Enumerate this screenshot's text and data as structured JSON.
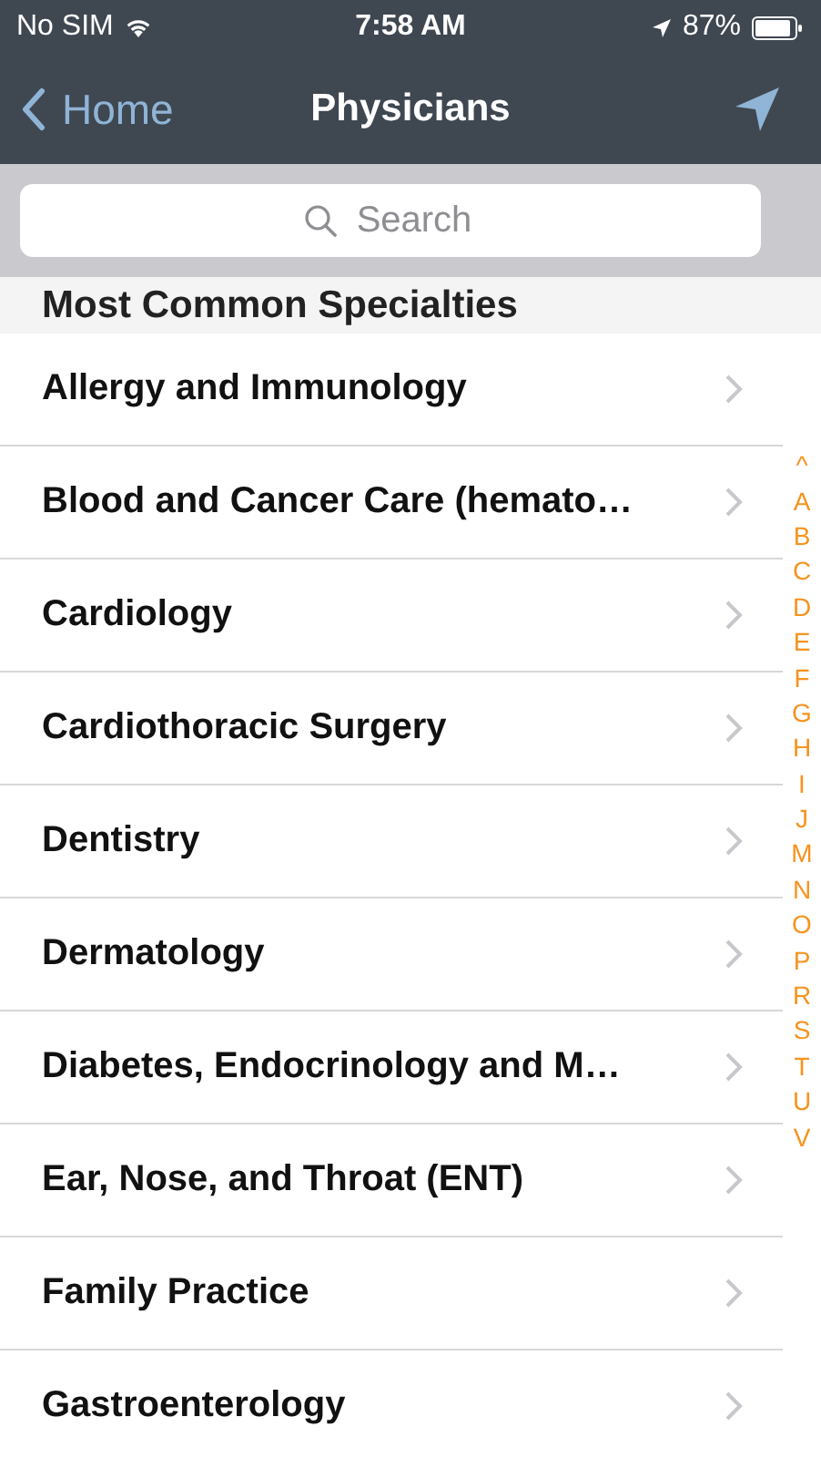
{
  "status_bar": {
    "carrier": "No SIM",
    "time": "7:58 AM",
    "battery": "87%"
  },
  "nav": {
    "back": "Home",
    "title": "Physicians"
  },
  "search": {
    "placeholder": "Search"
  },
  "section": {
    "title": "Most Common Specialties"
  },
  "rows": [
    "Allergy and Immunology",
    "Blood and Cancer Care (hemato…",
    "Cardiology",
    "Cardiothoracic Surgery",
    "Dentistry",
    "Dermatology",
    "Diabetes, Endocrinology and M…",
    "Ear, Nose, and Throat (ENT)",
    "Family Practice",
    "Gastroenterology"
  ],
  "index": [
    "^",
    "A",
    "B",
    "C",
    "D",
    "E",
    "F",
    "G",
    "H",
    "I",
    "J",
    "M",
    "N",
    "O",
    "P",
    "R",
    "S",
    "T",
    "U",
    "V"
  ]
}
